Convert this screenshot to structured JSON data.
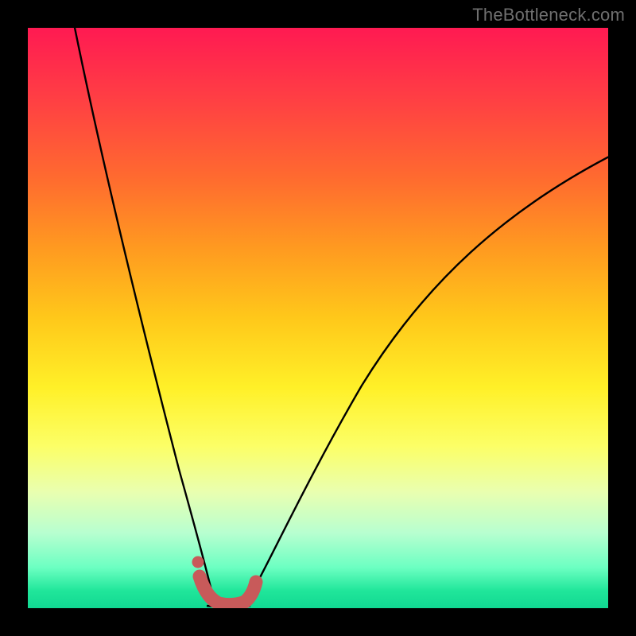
{
  "watermark": "TheBottleneck.com",
  "colors": {
    "frame": "#000000",
    "gradient_top": "#ff1a52",
    "gradient_bottom": "#11d892",
    "curve": "#000000",
    "marker": "#c85a5a"
  },
  "chart_data": {
    "type": "line",
    "title": "",
    "xlabel": "",
    "ylabel": "",
    "xlim": [
      0,
      100
    ],
    "ylim": [
      0,
      100
    ],
    "grid": false,
    "notes": "No axis ticks or numeric labels are rendered; curve shape is qualitative (bottleneck V-curve). Values below are plot-fraction estimates read from the image (0 = left/bottom, 1 = right/top).",
    "series": [
      {
        "name": "left-branch",
        "x_frac": [
          0.075,
          0.12,
          0.17,
          0.21,
          0.24,
          0.265,
          0.285,
          0.3,
          0.315
        ],
        "y_frac": [
          1.0,
          0.78,
          0.55,
          0.35,
          0.2,
          0.11,
          0.055,
          0.025,
          0.005
        ]
      },
      {
        "name": "right-branch",
        "x_frac": [
          0.37,
          0.4,
          0.45,
          0.52,
          0.6,
          0.7,
          0.82,
          0.92,
          1.0
        ],
        "y_frac": [
          0.005,
          0.04,
          0.12,
          0.24,
          0.38,
          0.52,
          0.65,
          0.73,
          0.78
        ]
      }
    ],
    "valley_floor": {
      "x_frac_range": [
        0.3,
        0.385
      ],
      "y_frac": 0.0
    },
    "marker_segment": {
      "description": "thick rounded pink segment tracing the valley bottom",
      "points_frac": [
        [
          0.295,
          0.055
        ],
        [
          0.305,
          0.025
        ],
        [
          0.325,
          0.006
        ],
        [
          0.355,
          0.006
        ],
        [
          0.375,
          0.02
        ],
        [
          0.385,
          0.045
        ]
      ],
      "dot_frac": [
        0.297,
        0.075
      ]
    }
  }
}
